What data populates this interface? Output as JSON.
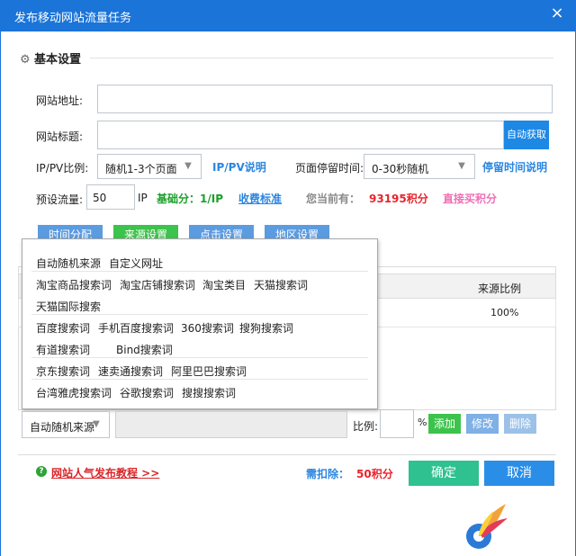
{
  "window": {
    "title": "发布移动网站流量任务",
    "close": "×"
  },
  "section": {
    "title": "基本设置"
  },
  "form": {
    "site_url_label": "网站地址:",
    "site_url_value": "",
    "site_title_label": "网站标题:",
    "site_title_value": "",
    "auto_fetch": "自动获取",
    "ippv_label": "IP/PV比例:",
    "ippv_value": "随机1-3个页面",
    "ippv_help": "IP/PV说明",
    "stay_label": "页面停留时间:",
    "stay_value": "0-30秒随机",
    "stay_help": "停留时间说明",
    "traffic_label": "预设流量:",
    "traffic_value": "50",
    "traffic_unit": "IP",
    "base_score": "基础分：1/IP",
    "fee_link": "收费标准",
    "current_label": "您当前有：",
    "current_points": "93195积分",
    "buy_link": "直接买积分"
  },
  "tabs": [
    {
      "label": "时间分配",
      "active": false
    },
    {
      "label": "来源设置",
      "active": true
    },
    {
      "label": "点击设置",
      "active": false
    },
    {
      "label": "地区设置",
      "active": false
    }
  ],
  "table": {
    "col_ratio": "来源比例",
    "row_ratio": "100%"
  },
  "dropdown": {
    "items": [
      [
        "自动随机来源",
        "自定义网址"
      ],
      [
        "淘宝商品搜索词",
        "淘宝店铺搜索词",
        "淘宝类目",
        "天猫搜索词"
      ],
      [
        "天猫国际搜索"
      ],
      [
        "百度搜索词",
        "手机百度搜索词",
        "360搜索词",
        "搜狗搜索词"
      ],
      [
        "有道搜索词",
        "Bind搜索词"
      ],
      [
        "京东搜索词",
        "速卖通搜索词",
        "阿里巴巴搜索词"
      ],
      [
        "台湾雅虎搜索词",
        "谷歌搜索词",
        "搜搜搜索词"
      ]
    ]
  },
  "source_row": {
    "select_value": "自动随机来‌源",
    "ratio_label": "比例:",
    "ratio_value": "",
    "percent": "%",
    "add": "添加",
    "edit": "修改",
    "delete": "删除"
  },
  "footer": {
    "tutorial": "网站人气发布教程 >>",
    "deduct_label": "需扣除：",
    "deduct_value": "50积分",
    "confirm": "确定",
    "cancel": "取消"
  },
  "colors": {
    "titlebar": "#1b74d8",
    "tab_active": "#3cc34b",
    "tab": "#5b9be0",
    "confirm": "#2fc18f",
    "cancel": "#2a8ee8"
  }
}
